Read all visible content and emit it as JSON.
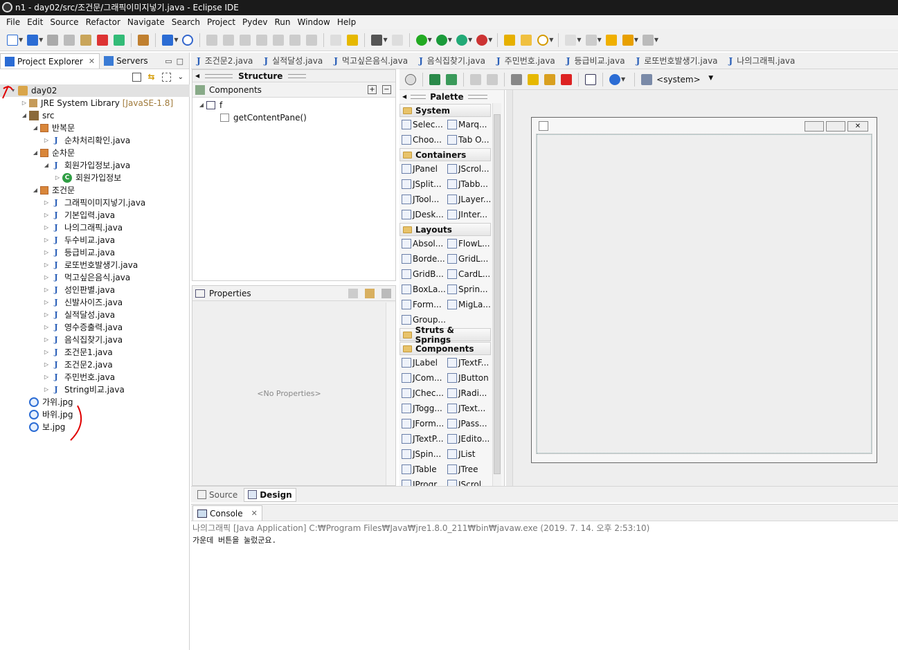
{
  "window": {
    "title": "n1 - day02/src/조건문/그래픽이미지넣기.java - Eclipse IDE"
  },
  "menu": [
    "File",
    "Edit",
    "Source",
    "Refactor",
    "Navigate",
    "Search",
    "Project",
    "Pydev",
    "Run",
    "Window",
    "Help"
  ],
  "left_tabs": {
    "project_explorer": "Project Explorer",
    "servers": "Servers"
  },
  "tree": [
    {
      "label": "day02",
      "indent": 0,
      "icon": "project-icon",
      "twisty": "▾"
    },
    {
      "label": "JRE System Library",
      "suffix": "[JavaSE-1.8]",
      "indent": 1,
      "icon": "library-icon",
      "twisty": "▷"
    },
    {
      "label": "src",
      "indent": 1,
      "icon": "source-folder-icon",
      "twisty": "◢"
    },
    {
      "label": "반복문",
      "indent": 2,
      "icon": "package-icon",
      "twisty": "◢"
    },
    {
      "label": "순차처리확인.java",
      "indent": 3,
      "icon": "java-file-icon",
      "twisty": "▷"
    },
    {
      "label": "순차문",
      "indent": 2,
      "icon": "package-icon",
      "twisty": "◢"
    },
    {
      "label": "회원가입정보.java",
      "indent": 3,
      "icon": "java-file-icon",
      "twisty": "◢"
    },
    {
      "label": "회원가입정보",
      "indent": 4,
      "icon": "class-icon",
      "twisty": "▷"
    },
    {
      "label": "조건문",
      "indent": 2,
      "icon": "package-icon",
      "twisty": "◢"
    },
    {
      "label": "그래픽이미지넣기.java",
      "indent": 3,
      "icon": "java-file-icon",
      "twisty": "▷"
    },
    {
      "label": "기본입력.java",
      "indent": 3,
      "icon": "java-file-icon",
      "twisty": "▷"
    },
    {
      "label": "나의그래픽.java",
      "indent": 3,
      "icon": "java-file-icon",
      "twisty": "▷"
    },
    {
      "label": "두수비교.java",
      "indent": 3,
      "icon": "java-file-icon",
      "twisty": "▷"
    },
    {
      "label": "등급비교.java",
      "indent": 3,
      "icon": "java-file-icon",
      "twisty": "▷"
    },
    {
      "label": "로또번호발생기.java",
      "indent": 3,
      "icon": "java-file-icon",
      "twisty": "▷"
    },
    {
      "label": "먹고싶은음식.java",
      "indent": 3,
      "icon": "java-file-icon",
      "twisty": "▷"
    },
    {
      "label": "성인판별.java",
      "indent": 3,
      "icon": "java-file-icon",
      "twisty": "▷"
    },
    {
      "label": "신발사이즈.java",
      "indent": 3,
      "icon": "java-file-icon",
      "twisty": "▷"
    },
    {
      "label": "실적달성.java",
      "indent": 3,
      "icon": "java-file-icon",
      "twisty": "▷"
    },
    {
      "label": "영수증출력.java",
      "indent": 3,
      "icon": "java-file-icon",
      "twisty": "▷"
    },
    {
      "label": "음식집찾기.java",
      "indent": 3,
      "icon": "java-file-icon",
      "twisty": "▷"
    },
    {
      "label": "조건문1.java",
      "indent": 3,
      "icon": "java-file-icon",
      "twisty": "▷"
    },
    {
      "label": "조건문2.java",
      "indent": 3,
      "icon": "java-file-icon",
      "twisty": "▷"
    },
    {
      "label": "주민번호.java",
      "indent": 3,
      "icon": "java-file-icon",
      "twisty": "▷"
    },
    {
      "label": "String비교.java",
      "indent": 3,
      "icon": "java-file-icon",
      "twisty": "▷"
    },
    {
      "label": "가위.jpg",
      "indent": 1,
      "icon": "image-file-icon",
      "twisty": ""
    },
    {
      "label": "바위.jpg",
      "indent": 1,
      "icon": "image-file-icon",
      "twisty": ""
    },
    {
      "label": "보.jpg",
      "indent": 1,
      "icon": "image-file-icon",
      "twisty": ""
    }
  ],
  "editor_tabs": [
    "조건문2.java",
    "실적달성.java",
    "먹고싶은음식.java",
    "음식집찾기.java",
    "주민번호.java",
    "등급비교.java",
    "로또번호발생기.java",
    "나의그래픽.java"
  ],
  "structure": {
    "title": "Structure",
    "components_label": "Components",
    "root": "f",
    "child": "getContentPane()"
  },
  "properties": {
    "title": "Properties",
    "empty": "<No Properties>"
  },
  "designer": {
    "system_combo": "<system>"
  },
  "palette": {
    "title": "Palette",
    "categories": [
      {
        "name": "System",
        "items": [
          "Selec...",
          "Marq...",
          "Choo...",
          "Tab O..."
        ]
      },
      {
        "name": "Containers",
        "items": [
          "JPanel",
          "JScrol...",
          "JSplit...",
          "JTabb...",
          "JTool...",
          "JLayer...",
          "JDesk...",
          "JInter..."
        ]
      },
      {
        "name": "Layouts",
        "items": [
          "Absol...",
          "FlowL...",
          "Borde...",
          "GridL...",
          "GridB...",
          "CardL...",
          "BoxLa...",
          "Sprin...",
          "Form...",
          "MigLa...",
          "Group..."
        ]
      },
      {
        "name": "Struts & Springs",
        "items": []
      },
      {
        "name": "Components",
        "items": [
          "JLabel",
          "JTextF...",
          "JCom...",
          "JButton",
          "JChec...",
          "JRadi...",
          "JTogg...",
          "JText...",
          "JForm...",
          "JPass...",
          "JTextP...",
          "JEdito...",
          "JSpin...",
          "JList",
          "JTable",
          "JTree",
          "JProgr...",
          "JScrol..."
        ]
      }
    ]
  },
  "bottom_tabs": {
    "source": "Source",
    "design": "Design"
  },
  "console": {
    "tab": "Console",
    "header": "나의그래픽 [Java Application] C:₩Program Files₩Java₩jre1.8.0_211₩bin₩javaw.exe (2019. 7. 14. 오후 2:53:10)",
    "output": "가운데 버튼을 눌렀군요."
  },
  "colors": {
    "annotation": "#e00000",
    "accent": "#2b6cd4",
    "title_bg": "#1a1a1a"
  }
}
